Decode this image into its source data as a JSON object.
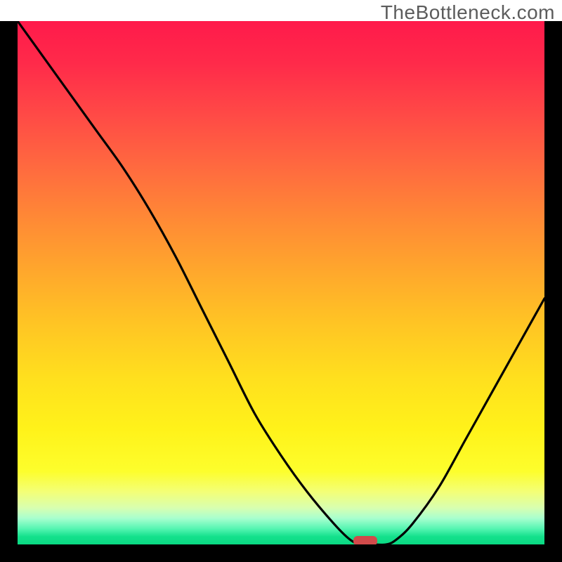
{
  "domain": "Chart",
  "watermark": "TheBottleneck.com",
  "colors": {
    "curve": "#000000",
    "marker": "#d14a4a",
    "frame": "#000000",
    "grad_top": "#ff1a4b",
    "grad_bottom": "#0ad983"
  },
  "chart_data": {
    "type": "line",
    "title": "",
    "xlabel": "",
    "ylabel": "",
    "xlim": [
      0,
      100
    ],
    "ylim": [
      0,
      100
    ],
    "axes_visible": false,
    "grid": false,
    "legend": false,
    "background": "vertical-gradient red→orange→yellow→green",
    "series": [
      {
        "name": "bottleneck-curve",
        "x": [
          0,
          5,
          10,
          15,
          20,
          25,
          30,
          35,
          40,
          45,
          50,
          55,
          60,
          63,
          65,
          67,
          70,
          72,
          75,
          80,
          85,
          90,
          95,
          100
        ],
        "y": [
          100,
          93,
          86,
          79,
          72,
          64,
          55,
          45,
          35,
          25,
          17,
          10,
          4,
          1,
          0,
          0,
          0,
          1,
          4,
          11,
          20,
          29,
          38,
          47
        ]
      }
    ],
    "marker": {
      "name": "optimal-point",
      "x": 66,
      "y": 0,
      "shape": "rounded-bar"
    },
    "notes": "No numeric axis ticks or labels are rendered; values estimated as percentages of plot area."
  }
}
